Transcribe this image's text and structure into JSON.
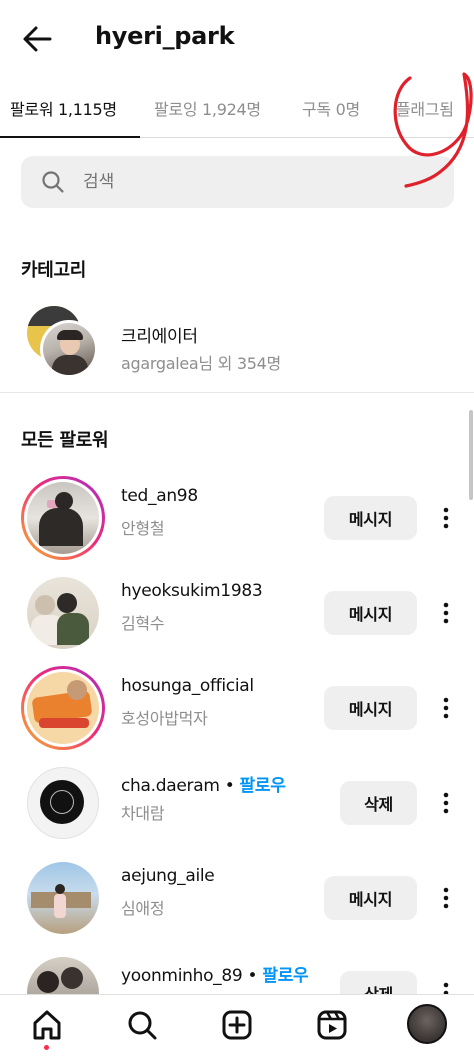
{
  "header": {
    "back_icon": "arrow-left-icon",
    "username": "hyeri_park"
  },
  "tabs": [
    {
      "label": "팔로워 1,115명",
      "active": true
    },
    {
      "label": "팔로잉 1,924명",
      "active": false
    },
    {
      "label": "구독 0명",
      "active": false
    },
    {
      "label": "플래그됨",
      "active": false
    }
  ],
  "search": {
    "placeholder": "검색",
    "value": ""
  },
  "category_section": {
    "title": "카테고리",
    "item": {
      "name": "크리에이터",
      "subtitle": "agargalea님 외 354명"
    }
  },
  "followers_section": {
    "title": "모든 팔로워",
    "rows": [
      {
        "username": "ted_an98",
        "name": "안형철",
        "follow_link": "",
        "button": "메시지",
        "story_ring": true
      },
      {
        "username": "hyeoksukim1983",
        "name": "김혁수",
        "follow_link": "",
        "button": "메시지",
        "story_ring": false
      },
      {
        "username": "hosunga_official",
        "name": "호성아밥먹자",
        "follow_link": "",
        "button": "메시지",
        "story_ring": true
      },
      {
        "username": "cha.daeram",
        "name": "차대람",
        "follow_link": "팔로우",
        "button": "삭제",
        "story_ring": false
      },
      {
        "username": "aejung_aile",
        "name": "심애정",
        "follow_link": "",
        "button": "메시지",
        "story_ring": false
      },
      {
        "username": "yoonminho_89",
        "name": "",
        "follow_link": "팔로우",
        "button": "삭제",
        "story_ring": false
      }
    ]
  },
  "bottom_nav": {
    "items": [
      "home-icon",
      "search-icon",
      "create-icon",
      "reels-icon",
      "profile-avatar"
    ]
  },
  "colors": {
    "accent_blue": "#0095f6",
    "button_bg": "#efefef",
    "annotation_red": "#e0202a"
  }
}
